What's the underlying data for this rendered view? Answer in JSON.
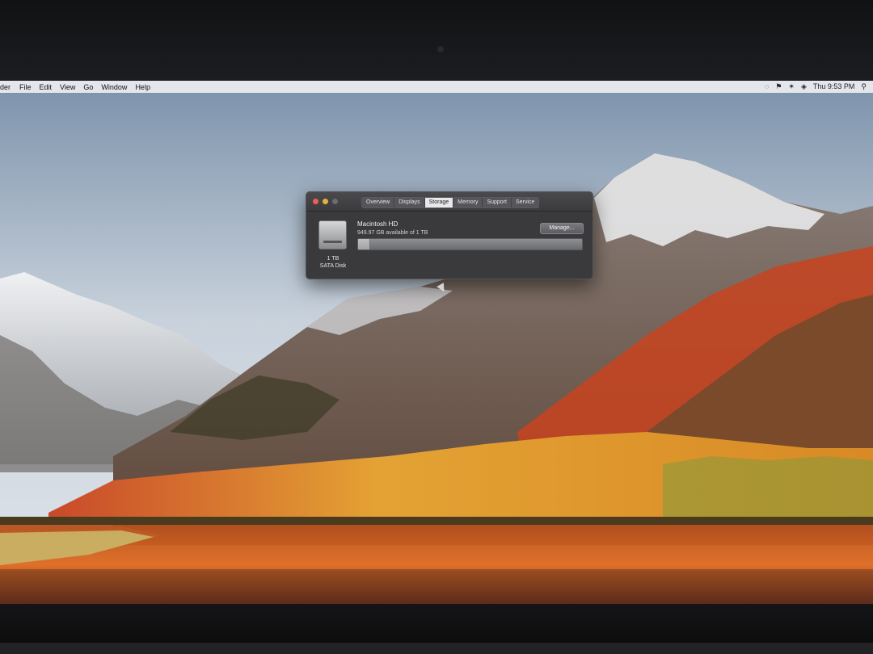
{
  "menubar": {
    "app": "der",
    "items": [
      "File",
      "Edit",
      "View",
      "Go",
      "Window",
      "Help"
    ],
    "clock": "Thu 9:53 PM",
    "icons": [
      "creative-cloud-icon",
      "flag-icon",
      "bluetooth-icon",
      "wifi-icon",
      "search-icon"
    ]
  },
  "about_window": {
    "tabs": [
      "Overview",
      "Displays",
      "Storage",
      "Memory",
      "Support",
      "Service"
    ],
    "active_tab": "Storage",
    "volume_name": "Macintosh HD",
    "available_text": "949.97 GB available of 1 TB",
    "used_fraction": 0.05,
    "manage_label": "Manage...",
    "disk_size": "1 TB",
    "disk_type": "SATA Disk"
  },
  "colors": {
    "window_bg": "#3a3a3c",
    "close": "#ec5f58",
    "minimize": "#e2b23a",
    "zoom_disabled": "#6d6d70"
  }
}
